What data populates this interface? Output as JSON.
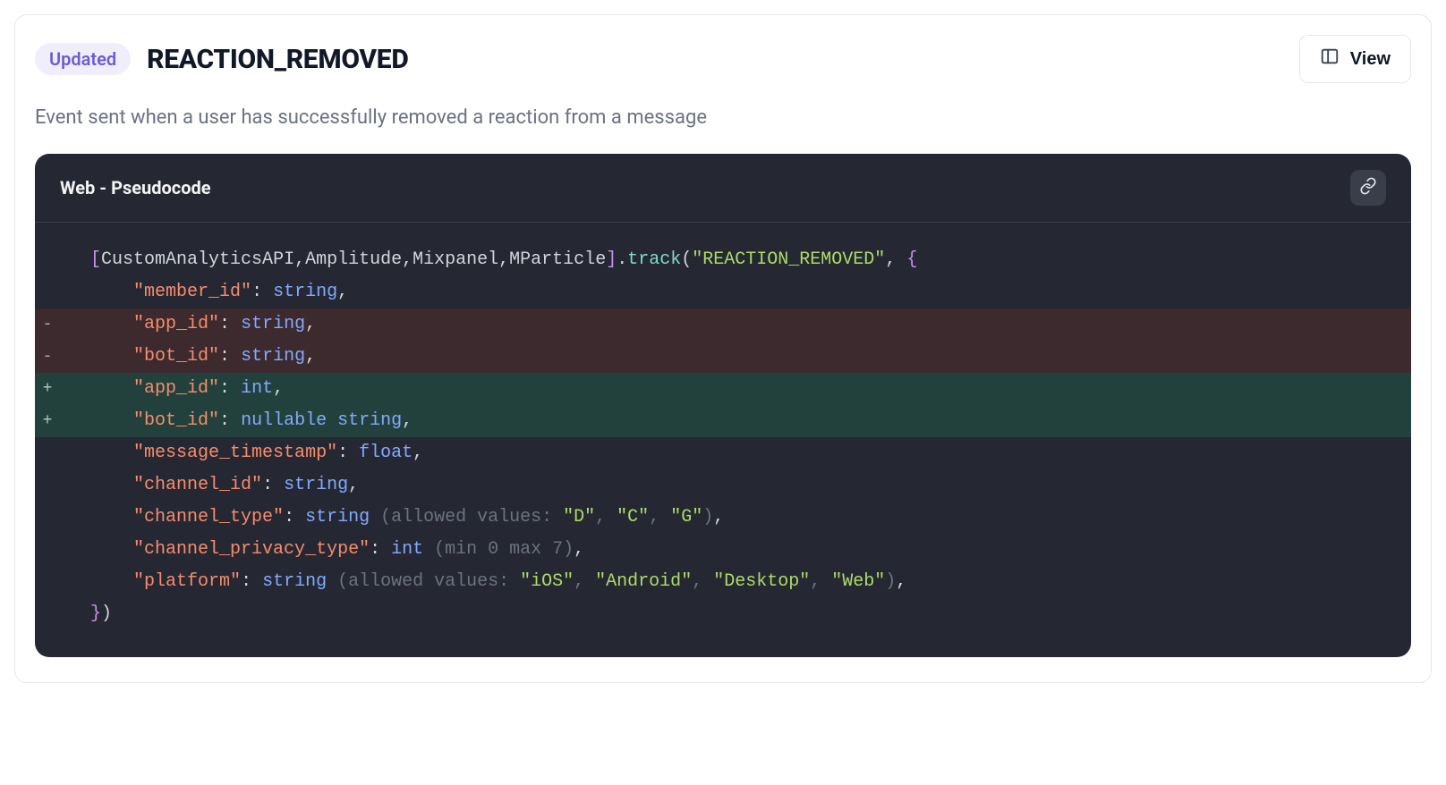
{
  "header": {
    "badge": "Updated",
    "title": "REACTION_REMOVED",
    "view_label": "View"
  },
  "description": "Event sent when a user has successfully removed a reaction from a message",
  "code": {
    "title": "Web - Pseudocode",
    "providers": [
      "CustomAnalyticsAPI",
      "Amplitude",
      "Mixpanel",
      "MParticle"
    ],
    "method": "track",
    "event_name": "REACTION_REMOVED",
    "diff_lines": [
      {
        "kind": "context",
        "indent": 0,
        "segments": [
          {
            "cls": "t-bracket",
            "t": "["
          },
          {
            "cls": "t-ident",
            "t": "CustomAnalyticsAPI"
          },
          {
            "cls": "t-punc",
            "t": ","
          },
          {
            "cls": "t-ident",
            "t": "Amplitude"
          },
          {
            "cls": "t-punc",
            "t": ","
          },
          {
            "cls": "t-ident",
            "t": "Mixpanel"
          },
          {
            "cls": "t-punc",
            "t": ","
          },
          {
            "cls": "t-ident",
            "t": "MParticle"
          },
          {
            "cls": "t-bracket",
            "t": "]"
          },
          {
            "cls": "t-punc",
            "t": "."
          },
          {
            "cls": "t-method",
            "t": "track"
          },
          {
            "cls": "t-punc",
            "t": "("
          },
          {
            "cls": "t-string",
            "t": "\"REACTION_REMOVED\""
          },
          {
            "cls": "t-punc",
            "t": ", "
          },
          {
            "cls": "t-bracket",
            "t": "{"
          }
        ]
      },
      {
        "kind": "context",
        "indent": 2,
        "segments": [
          {
            "cls": "t-key",
            "t": "\"member_id\""
          },
          {
            "cls": "t-punc",
            "t": ": "
          },
          {
            "cls": "t-type",
            "t": "string"
          },
          {
            "cls": "t-punc",
            "t": ","
          }
        ]
      },
      {
        "kind": "removed",
        "indent": 2,
        "segments": [
          {
            "cls": "t-key",
            "t": "\"app_id\""
          },
          {
            "cls": "t-punc",
            "t": ": "
          },
          {
            "cls": "t-type",
            "t": "string"
          },
          {
            "cls": "t-punc",
            "t": ","
          }
        ]
      },
      {
        "kind": "removed",
        "indent": 2,
        "segments": [
          {
            "cls": "t-key",
            "t": "\"bot_id\""
          },
          {
            "cls": "t-punc",
            "t": ": "
          },
          {
            "cls": "t-type",
            "t": "string"
          },
          {
            "cls": "t-punc",
            "t": ","
          }
        ]
      },
      {
        "kind": "added",
        "indent": 2,
        "segments": [
          {
            "cls": "t-key",
            "t": "\"app_id\""
          },
          {
            "cls": "t-punc",
            "t": ": "
          },
          {
            "cls": "t-type",
            "t": "int"
          },
          {
            "cls": "t-punc",
            "t": ","
          }
        ]
      },
      {
        "kind": "added",
        "indent": 2,
        "segments": [
          {
            "cls": "t-key",
            "t": "\"bot_id\""
          },
          {
            "cls": "t-punc",
            "t": ": "
          },
          {
            "cls": "t-type",
            "t": "nullable string"
          },
          {
            "cls": "t-punc",
            "t": ","
          }
        ]
      },
      {
        "kind": "context",
        "indent": 2,
        "segments": [
          {
            "cls": "t-key",
            "t": "\"message_timestamp\""
          },
          {
            "cls": "t-punc",
            "t": ": "
          },
          {
            "cls": "t-type",
            "t": "float"
          },
          {
            "cls": "t-punc",
            "t": ","
          }
        ]
      },
      {
        "kind": "context",
        "indent": 2,
        "segments": [
          {
            "cls": "t-key",
            "t": "\"channel_id\""
          },
          {
            "cls": "t-punc",
            "t": ": "
          },
          {
            "cls": "t-type",
            "t": "string"
          },
          {
            "cls": "t-punc",
            "t": ","
          }
        ]
      },
      {
        "kind": "context",
        "indent": 2,
        "segments": [
          {
            "cls": "t-key",
            "t": "\"channel_type\""
          },
          {
            "cls": "t-punc",
            "t": ": "
          },
          {
            "cls": "t-type",
            "t": "string"
          },
          {
            "cls": "t-paren",
            "t": " (allowed values: "
          },
          {
            "cls": "t-string",
            "t": "\"D\""
          },
          {
            "cls": "t-paren",
            "t": ", "
          },
          {
            "cls": "t-string",
            "t": "\"C\""
          },
          {
            "cls": "t-paren",
            "t": ", "
          },
          {
            "cls": "t-string",
            "t": "\"G\""
          },
          {
            "cls": "t-paren",
            "t": ")"
          },
          {
            "cls": "t-punc",
            "t": ","
          }
        ]
      },
      {
        "kind": "context",
        "indent": 2,
        "segments": [
          {
            "cls": "t-key",
            "t": "\"channel_privacy_type\""
          },
          {
            "cls": "t-punc",
            "t": ": "
          },
          {
            "cls": "t-type",
            "t": "int"
          },
          {
            "cls": "t-paren",
            "t": " (min 0 max 7)"
          },
          {
            "cls": "t-punc",
            "t": ","
          }
        ]
      },
      {
        "kind": "context",
        "indent": 2,
        "segments": [
          {
            "cls": "t-key",
            "t": "\"platform\""
          },
          {
            "cls": "t-punc",
            "t": ": "
          },
          {
            "cls": "t-type",
            "t": "string"
          },
          {
            "cls": "t-paren",
            "t": " (allowed values: "
          },
          {
            "cls": "t-string",
            "t": "\"iOS\""
          },
          {
            "cls": "t-paren",
            "t": ", "
          },
          {
            "cls": "t-string",
            "t": "\"Android\""
          },
          {
            "cls": "t-paren",
            "t": ", "
          },
          {
            "cls": "t-string",
            "t": "\"Desktop\""
          },
          {
            "cls": "t-paren",
            "t": ", "
          },
          {
            "cls": "t-string",
            "t": "\"Web\""
          },
          {
            "cls": "t-paren",
            "t": ")"
          },
          {
            "cls": "t-punc",
            "t": ","
          }
        ]
      },
      {
        "kind": "context",
        "indent": 0,
        "segments": [
          {
            "cls": "t-bracket",
            "t": "}"
          },
          {
            "cls": "t-punc",
            "t": ")"
          }
        ]
      }
    ]
  }
}
